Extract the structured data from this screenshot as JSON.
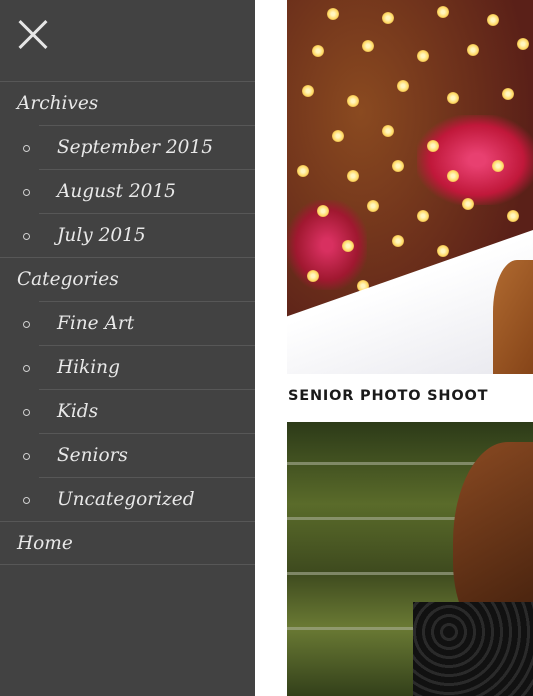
{
  "drawer": {
    "close_label": "Close menu",
    "menu": [
      {
        "type": "heading",
        "label": "Archives"
      },
      {
        "type": "sub",
        "label": "September 2015"
      },
      {
        "type": "sub",
        "label": "August 2015"
      },
      {
        "type": "sub",
        "label": "July 2015"
      },
      {
        "type": "heading",
        "label": "Categories"
      },
      {
        "type": "sub",
        "label": "Fine Art"
      },
      {
        "type": "sub",
        "label": "Hiking"
      },
      {
        "type": "sub",
        "label": "Kids"
      },
      {
        "type": "sub",
        "label": "Seniors"
      },
      {
        "type": "sub",
        "label": "Uncategorized"
      },
      {
        "type": "heading",
        "label": "Home"
      }
    ]
  },
  "content": {
    "post_title": "SENIOR PHOTO SHOOT"
  }
}
